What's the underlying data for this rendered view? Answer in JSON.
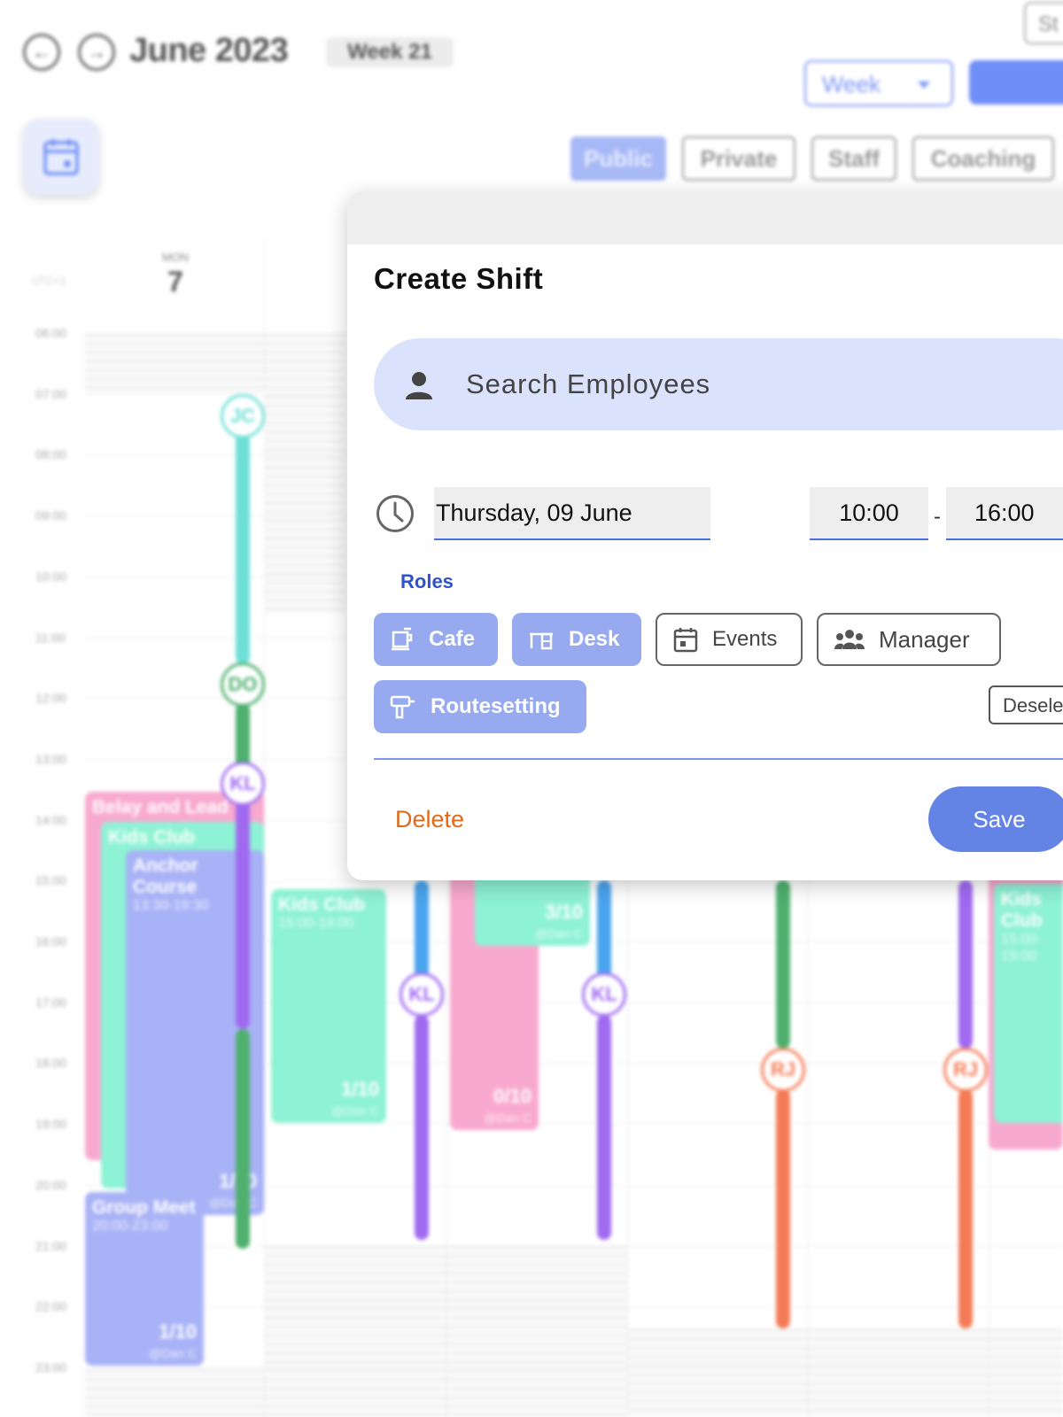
{
  "header": {
    "month_title": "June 2023",
    "week_badge": "Week 21",
    "view_select": "Week",
    "top_right_button": "St"
  },
  "filters": [
    {
      "label": "Public",
      "active": true
    },
    {
      "label": "Private",
      "active": false
    },
    {
      "label": "Staff",
      "active": false
    },
    {
      "label": "Coaching",
      "active": false
    }
  ],
  "calendar": {
    "timezone": "UTC+1",
    "day": {
      "name": "MON",
      "number": "7"
    },
    "hours": [
      "06:00",
      "07:00",
      "08:00",
      "09:00",
      "10:00",
      "11:00",
      "12:00",
      "13:00",
      "14:00",
      "15:00",
      "16:00",
      "17:00",
      "18:00",
      "19:00",
      "20:00",
      "21:00",
      "22:00",
      "23:00"
    ],
    "events": [
      {
        "title": "Belay and Lead",
        "time": "",
        "count": "",
        "who": ""
      },
      {
        "title": "Kids Club",
        "time": "",
        "count": "",
        "who": ""
      },
      {
        "title": "Anchor Course",
        "time": "13:30-19:30",
        "count": "1/10",
        "who": "@Dan C"
      },
      {
        "title": "Group Meet",
        "time": "20:00-23:00",
        "count": "1/10",
        "who": "@Dan C"
      },
      {
        "title": "Kids Club",
        "time": "15:00-19:00",
        "count": "1/10",
        "who": "@Dan C"
      },
      {
        "title": "",
        "time": "",
        "count": "0/10",
        "who": "@Dan C"
      },
      {
        "title": "",
        "time": "",
        "count": "3/10",
        "who": "@Dan C"
      },
      {
        "title": "Kids Club",
        "time": "15:00-19:00",
        "count": "",
        "who": ""
      }
    ],
    "initials": [
      "JC",
      "DO",
      "KL",
      "KL",
      "KL",
      "RJ",
      "RJ"
    ]
  },
  "modal": {
    "title": "Create Shift",
    "search_placeholder": "Search Employees",
    "date": "Thursday, 09 June",
    "start_time": "10:00",
    "end_time": "16:00",
    "time_separator": "-",
    "roles_label": "Roles",
    "roles": [
      {
        "label": "Cafe",
        "selected": true,
        "icon": "cup-icon"
      },
      {
        "label": "Desk",
        "selected": true,
        "icon": "desk-icon"
      },
      {
        "label": "Events",
        "selected": false,
        "icon": "calendar-icon"
      },
      {
        "label": "Manager",
        "selected": false,
        "icon": "group-icon"
      },
      {
        "label": "Routesetting",
        "selected": true,
        "icon": "drill-icon"
      }
    ],
    "deselect_label": "Deselect",
    "delete_label": "Delete",
    "save_label": "Save"
  },
  "colors": {
    "accent": "#6384e4",
    "role_selected": "#97aaf0",
    "search_bg": "#dbe3fc",
    "delete": "#e06a1a",
    "roles_label": "#2f52cc"
  }
}
